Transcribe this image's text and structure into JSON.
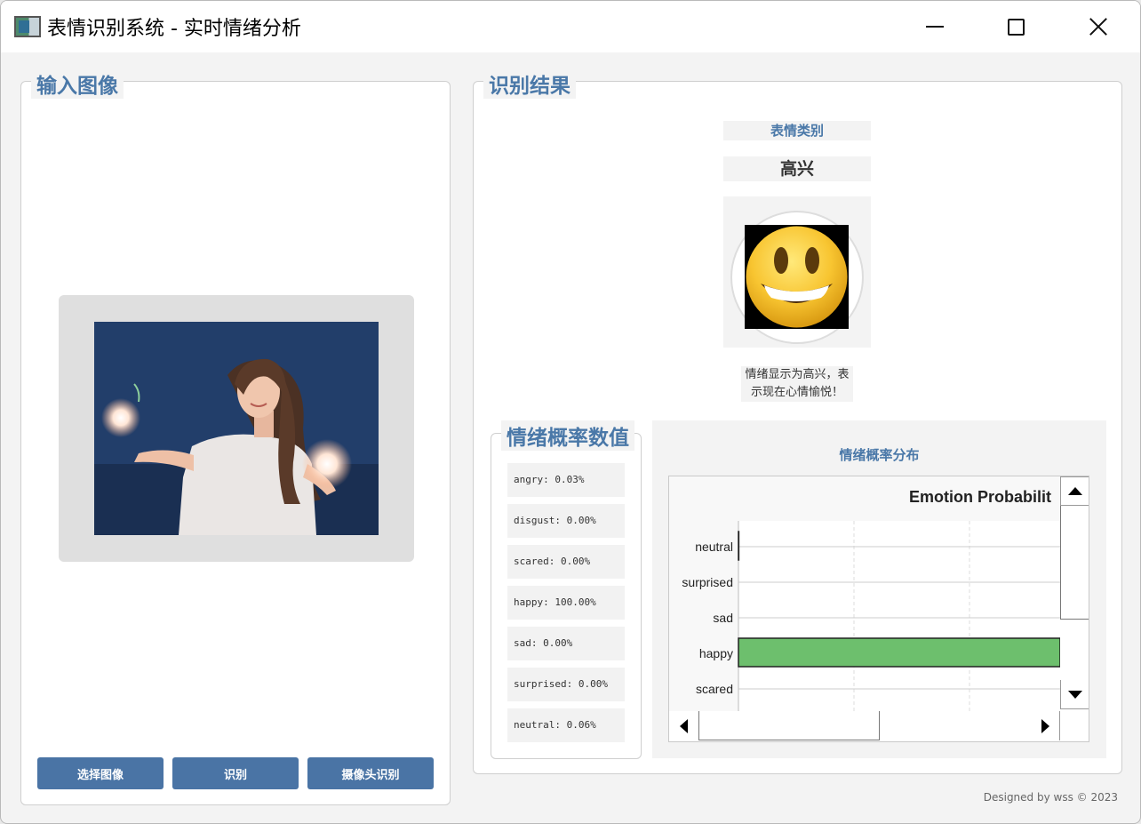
{
  "window": {
    "title": "表情识别系统 - 实时情绪分析"
  },
  "left_panel": {
    "title": "输入图像",
    "buttons": {
      "select_image": "选择图像",
      "recognize": "识别",
      "camera_recognize": "摄像头识别"
    }
  },
  "right_panel": {
    "title": "识别结果",
    "emotion_category_label": "表情类别",
    "emotion_result": "高兴",
    "description_line1": "情绪显示为高兴，表",
    "description_line2": "示现在心情愉悦！",
    "emoji_icon": "smiling-face-emoji"
  },
  "probability_panel": {
    "title": "情绪概率数值",
    "items": [
      "angry: 0.03%",
      "disgust: 0.00%",
      "scared: 0.00%",
      "happy: 100.00%",
      "sad: 0.00%",
      "surprised: 0.00%",
      "neutral: 0.06%"
    ]
  },
  "chart_section": {
    "heading": "情绪概率分布"
  },
  "chart_data": {
    "type": "bar",
    "orientation": "horizontal",
    "title": "Emotion Probabilit",
    "categories": [
      "neutral",
      "surprised",
      "sad",
      "happy",
      "scared"
    ],
    "values": [
      0.06,
      0.0,
      0.0,
      100.0,
      0.0
    ],
    "bar_color": "#6dbf6d",
    "grid": true
  },
  "footer": {
    "text": "Designed by wss © 2023"
  },
  "colors": {
    "accent": "#4a78a8",
    "button": "#4a74a5"
  }
}
